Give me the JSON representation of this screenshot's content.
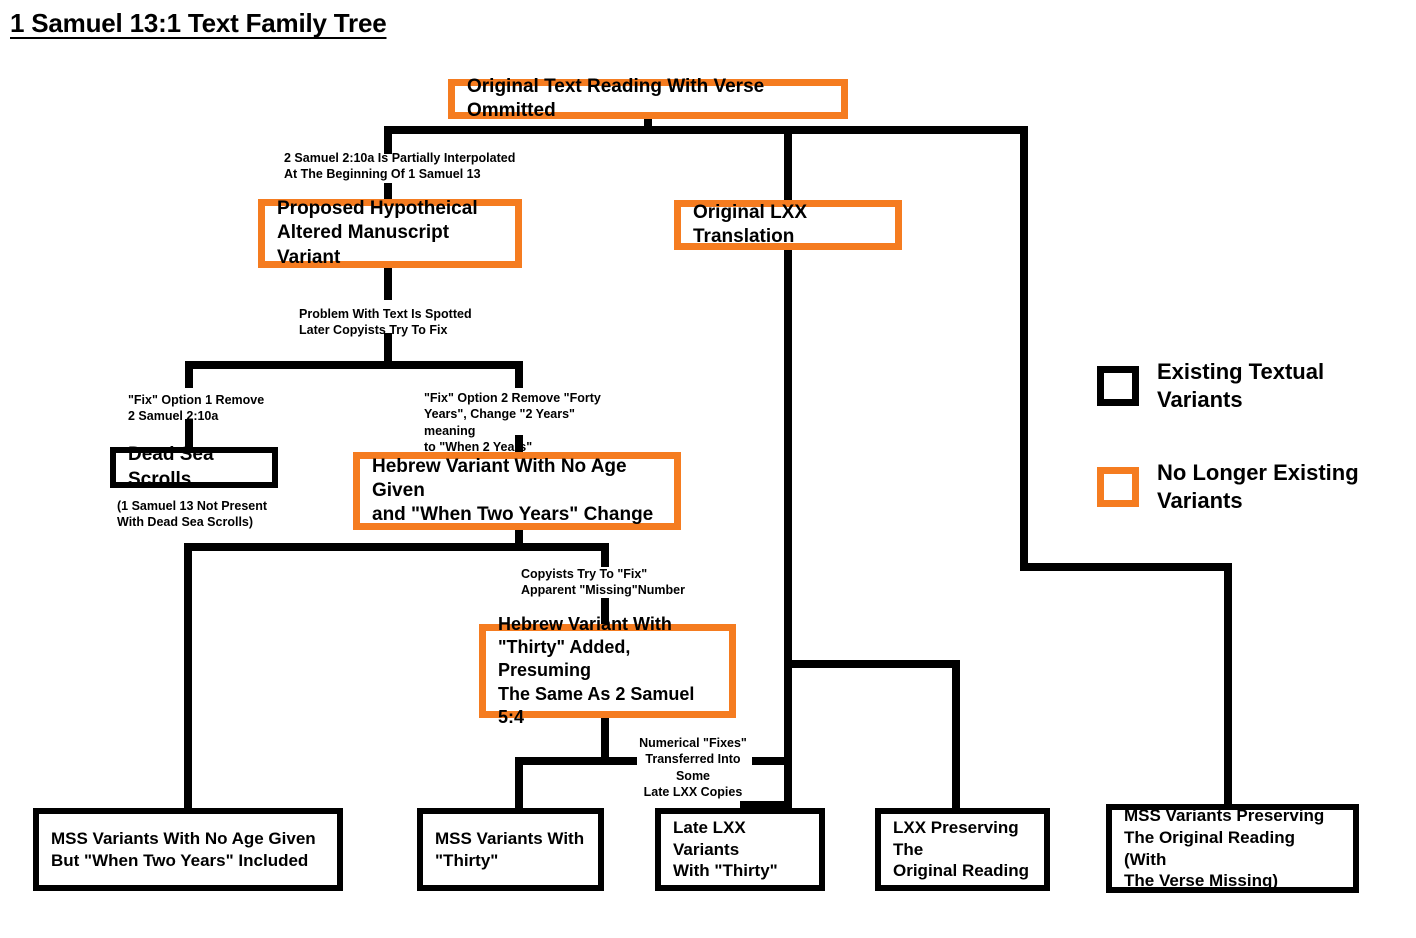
{
  "title": "1 Samuel 13:1 Text Family Tree",
  "colors": {
    "accent_orange": "#F57C20",
    "line_black": "#000000",
    "background": "#FFFFFF"
  },
  "legend": {
    "items": [
      {
        "swatch": "black-square",
        "label": "Existing Textual\nVariants"
      },
      {
        "swatch": "orange-square",
        "label": "No Longer Existing\nVariants"
      }
    ]
  },
  "nodes": {
    "root": {
      "label": "Original Text Reading With Verse Ommitted",
      "style": "orange",
      "category": "no-longer-existing"
    },
    "proposed_hypothetical": {
      "label": "Proposed Hypotheical\nAltered Manuscript Variant",
      "style": "orange",
      "category": "no-longer-existing"
    },
    "original_lxx": {
      "label": "Original LXX Translation",
      "style": "orange",
      "category": "no-longer-existing"
    },
    "dead_sea_scrolls": {
      "label": "Dead Sea Scrolls",
      "style": "black",
      "category": "existing"
    },
    "hebrew_no_age": {
      "label": "Hebrew Variant With No Age Given\nand \"When Two Years\" Change",
      "style": "orange",
      "category": "no-longer-existing"
    },
    "hebrew_thirty": {
      "label": "Hebrew Variant With\n\"Thirty\" Added, Presuming\nThe Same As 2 Samuel 5:4",
      "style": "orange",
      "category": "no-longer-existing"
    },
    "mss_no_age": {
      "label": "MSS Variants With No Age Given\nBut \"When Two Years\" Included",
      "style": "black",
      "category": "existing"
    },
    "mss_thirty": {
      "label": "MSS Variants With\n\"Thirty\"",
      "style": "black",
      "category": "existing"
    },
    "late_lxx_thirty": {
      "label": "Late LXX Variants\nWith \"Thirty\"",
      "style": "black",
      "category": "existing"
    },
    "lxx_original": {
      "label": "LXX Preserving The\nOriginal Reading",
      "style": "black",
      "category": "existing"
    },
    "mss_original": {
      "label": "MSS Variants Preserving\nThe Original Reading (With\nThe Verse Missing)",
      "style": "black",
      "category": "existing"
    }
  },
  "edge_labels": {
    "interpolated": "2 Samuel 2:10a Is Partially Interpolated\nAt The Beginning Of 1 Samuel 13",
    "problem_spotted": "Problem With Text Is Spotted\nLater Copyists Try To Fix",
    "fix_option_1": "\"Fix\" Option 1 Remove\n2 Samuel 2:10a",
    "fix_option_2": "\"Fix\" Option 2 Remove \"Forty\nYears\", Change \"2 Years\" meaning\nto \"When 2 Years\"",
    "dss_note": "(1 Samuel 13 Not Present\nWith Dead Sea Scrolls)",
    "copyists_missing": "Copyists Try To \"Fix\"\nApparent \"Missing\"Number",
    "numerical_fixes": "Numerical \"Fixes\"\nTransferred Into Some\nLate LXX Copies"
  }
}
